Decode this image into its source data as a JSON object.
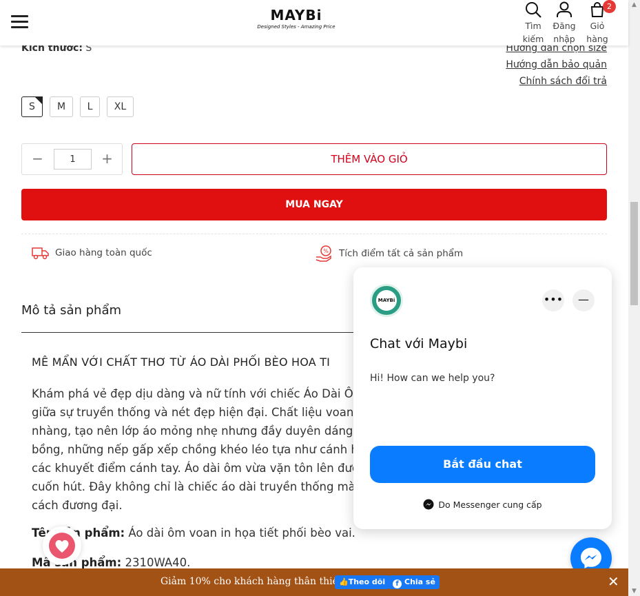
{
  "header": {
    "logo": "MAYBi",
    "tagline": "Designed Styles - Amazing Price",
    "search_label": "Tìm kiếm",
    "search_l1": "Tìm",
    "search_l2": "kiếm",
    "login_l1": "Đăng",
    "login_l2": "nhập",
    "cart_l1": "Giỏ",
    "cart_l2": "hàng",
    "cart_count": "2"
  },
  "product": {
    "size_label": "Kích thước:",
    "size_value": "S",
    "links": [
      "Hướng dẫn chọn size",
      "Hướng dẫn bảo quản",
      "Chính sách đổi trả"
    ],
    "sizes": [
      "S",
      "M",
      "L",
      "XL"
    ],
    "selected_size": "S",
    "quantity": "1",
    "qty_minus": "−",
    "qty_plus": "+",
    "add_to_cart": "THÊM VÀO GIỎ",
    "buy_now": "MUA NGAY",
    "perks": [
      "Giao hàng toàn quốc",
      "Tích điểm tất cả sản phẩm"
    ]
  },
  "description": {
    "title": "Mô tả sản phẩm",
    "heading": "MÊ MẨN VỚI CHẤT THƠ TỪ ÁO DÀI PHỐI BÈO HOA TI",
    "lines": [
      "Khám phá vẻ đẹp dịu dàng và nữ tính với chiếc Áo Dài Ô",
      "giữa sự truyền thống và nét đẹp hiện đại. Chất liệu voan",
      "nhàng, tạo nên lớp áo mỏng nhẹ nhưng đầy duyên dáng",
      "bồng, những nếp gấp xếp chồng khéo léo tựa như cánh h",
      "các khuyết điểm cánh tay. Áo dài ôm vừa vặn tôn lên đườ",
      "cuốn hút. Đây không chỉ là chiếc áo dài truyền thống mà",
      "cách đương đại."
    ],
    "name_label": "Tên sản phẩm:",
    "name_label_visible": "Tê   phẩm:",
    "name_value": "Áo dài ôm voan in họa tiết phối bèo vai.",
    "code_label": "Mã sản phẩm:",
    "code_value": "2310WA40."
  },
  "chat": {
    "avatar_text": "MAYBi",
    "more": "•••",
    "minimize": "—",
    "title": "Chat với Maybi",
    "message": "Hi! How can we help you?",
    "start_button": "Bắt đầu chat",
    "powered_by": "Do Messenger cung cấp"
  },
  "bottom_bar": {
    "promo": "Giảm 10% cho khách hàng thân thiết",
    "follow": "Theo dõi",
    "share": "Chia sẻ",
    "close": "✕"
  },
  "colors": {
    "primary_red": "#e01010",
    "messenger_blue": "#0a7cff",
    "bar_brown": "#a35215",
    "heart_pink": "#e9566d"
  }
}
